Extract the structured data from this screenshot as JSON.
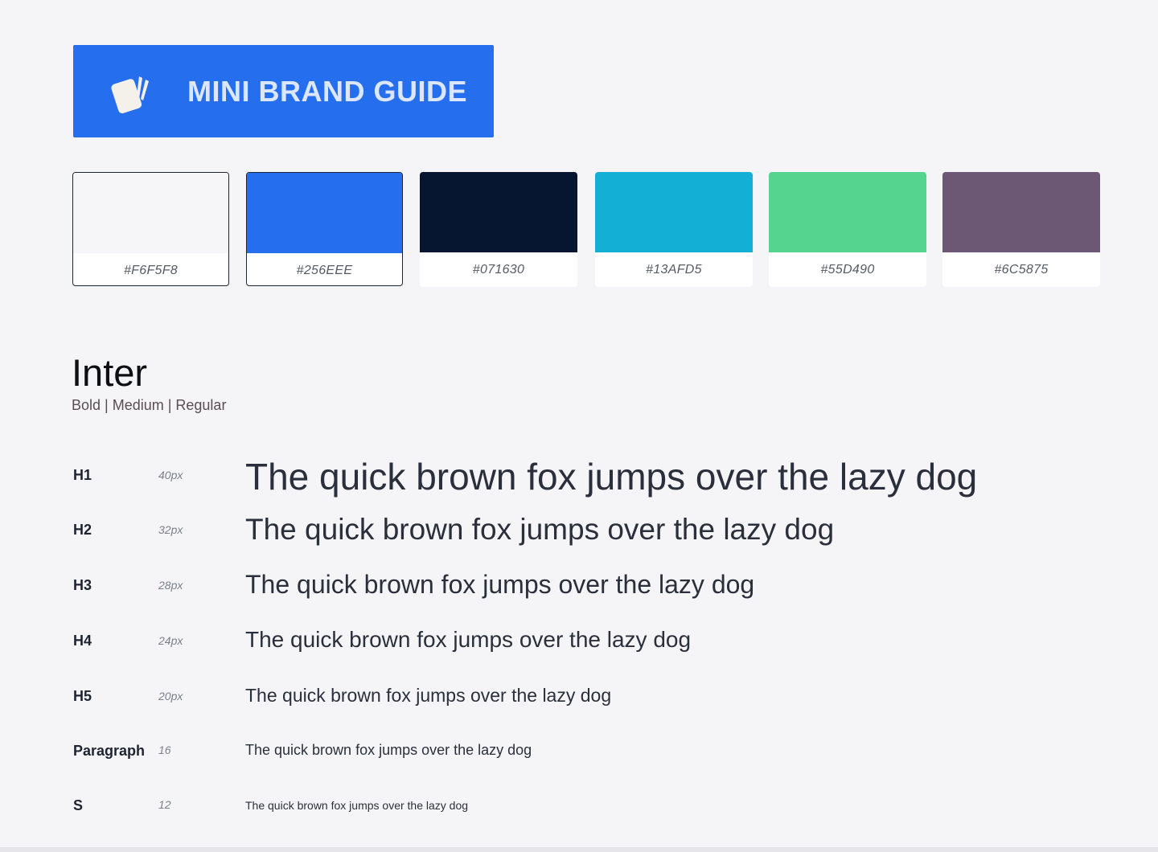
{
  "header": {
    "title": "MINI BRAND GUIDE",
    "logo_icon": "cards-logo-icon",
    "background": "#256EEE"
  },
  "palette": [
    {
      "hex": "#F6F5F8",
      "color": "#F6F5F8",
      "selected": true
    },
    {
      "hex": "#256EEE",
      "color": "#256EEE",
      "selected": true
    },
    {
      "hex": "#071630",
      "color": "#071630",
      "selected": false
    },
    {
      "hex": "#13AFD5",
      "color": "#13AFD5",
      "selected": false
    },
    {
      "hex": "#55D490",
      "color": "#55D490",
      "selected": false
    },
    {
      "hex": "#6C5875",
      "color": "#6C5875",
      "selected": false
    }
  ],
  "typography": {
    "font_name": "Inter",
    "weights": "Bold | Medium | Regular",
    "rows": [
      {
        "label": "H1",
        "size": "40px",
        "sample": "The quick brown fox jumps over the lazy dog"
      },
      {
        "label": "H2",
        "size": "32px",
        "sample": "The quick brown fox jumps over the lazy dog"
      },
      {
        "label": "H3",
        "size": "28px",
        "sample": "The quick brown fox jumps over the lazy dog"
      },
      {
        "label": "H4",
        "size": "24px",
        "sample": "The quick brown fox jumps over the lazy dog"
      },
      {
        "label": "H5",
        "size": "20px",
        "sample": "The quick brown fox jumps over the lazy dog"
      },
      {
        "label": "Paragraph",
        "size": "16",
        "sample": "The quick brown fox jumps over the lazy dog"
      },
      {
        "label": "S",
        "size": "12",
        "sample": "The quick brown fox jumps over the lazy dog"
      }
    ]
  }
}
